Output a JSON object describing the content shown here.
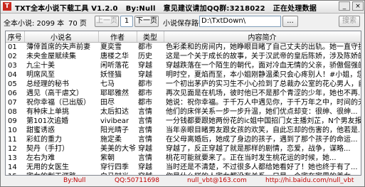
{
  "window": {
    "title": "TXT全本小说下载工具 V1.2.0   By:Null   意见建议请加QQ群:3218022   正在处理数据",
    "minimize": "_",
    "close": "×"
  },
  "toolbar": {
    "total_label": "全本小说: 2099 本",
    "pages_label": "70 页",
    "prev_button": "上一页",
    "page_number": "1",
    "next_button": "下一页",
    "save_path_label": "小说保存路径",
    "save_path_value": "D:\\TxtDown\\",
    "browse_button": "...",
    "search_button": "搜索"
  },
  "table": {
    "columns": [
      "序号",
      "小说名",
      "作者",
      "类型",
      "内容简介"
    ],
    "rows": [
      [
        "01",
        "薄倖首席的失声前妻",
        "夏奕雪",
        "都市",
        "色彩柔和的房间内，她睁眼目睹了自己丈夫的出轨。她一直守护..."
      ],
      [
        "02",
        "未央金屋赋续集",
        "唐楼之华",
        "历史",
        "这是一个关于成长的故事，关于汉武帝的皇后陈娇，涉及陈娇的..."
      ],
      [
        "03",
        "九尘十美",
        "闲听落花",
        "穿越",
        "穿越跌落在一个陌生的朝代，面对冷血无情的父亲，骄傲倔强的..."
      ],
      [
        "04",
        "明席风至",
        "妖怪猫",
        "穿越",
        "明时空，夏焰而至，本小姐刚静温柔只会心疼别人！#小姐，您..."
      ],
      [
        "05",
        "总经理的秘书",
        "七马",
        "都市",
        "一个初出茅庐的实习生不小心捡到了总裁办公室的花心男人，自..."
      ],
      [
        "06",
        "遇见（高干虐文）",
        "耶耶雅然",
        "都市",
        "再次见面是在机场，彼时他已不是那个青涩的少年，她也不再..."
      ],
      [
        "07",
        "祝你幸福（已出版）",
        "田尽",
        "都市",
        "她说：祝你幸福。于千万人中遇见你，于千万年之中，时间的无..."
      ],
      [
        "08",
        "有种床上单挑",
        "太后扣达",
        "言情",
        "他们的床伴关系一步一步升温，她们优点却变：很绅、很绅..."
      ],
      [
        "09",
        "第101次追婚",
        "vivibear",
        "言情",
        "一分钱都要跟她两份花的ic姐中国招门女主播刘芷，N个男友报..."
      ],
      [
        "10",
        "甜蜜诱惑",
        "阳光晴子",
        "言情",
        "当年亲眼目睹男友跟女孩的欢笑，自此忘却的伤害的，他若是..."
      ],
      [
        "11",
        "彩虹的重力",
        "施定柔",
        "言情",
        "在父母离婚后，她成了身边的孩子，遇到了那个孩子的命运..."
      ],
      [
        "12",
        "契丹（手打）",
        "美美的大爷",
        "穿越",
        "穿越了，反正穿越了就是那样的剧情，恋爱，战争，谋略..."
      ],
      [
        "13",
        "左右为难",
        "紫朝",
        "言情",
        "桃花可能就要来了。正在当时发生桃花运的时候，她..."
      ],
      [
        "14",
        "无用的女医生",
        "穿行四季",
        "穿越",
        "当时还是不清楚，不过很多人都给她看好了！她也终于有了..."
      ],
      [
        "15",
        "宅女的刺天涯路",
        "白马时光",
        "穿越",
        "你是什么样的人宅女都没有关系，只是一个宅在家里的美女..."
      ]
    ]
  },
  "status": {
    "author": "By:Null",
    "qq": "QQ:50711698",
    "email": "null_vbt@163.com",
    "blog": "http://hi.baidu.com/null_vbt"
  }
}
